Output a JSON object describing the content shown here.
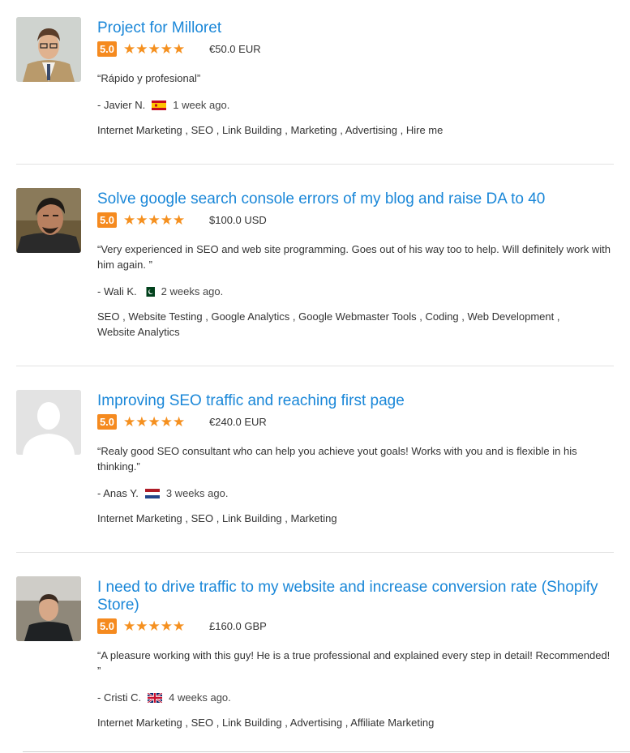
{
  "reviews": [
    {
      "title": "Project for Milloret",
      "score": "5.0",
      "stars": "★★★★★",
      "amount": "€50.0 EUR",
      "comment": "“Rápido y profesional”",
      "author": "- Javier N.",
      "flag": "spain-flag-icon",
      "ago": "1 week ago.",
      "skills": [
        "Internet Marketing",
        "SEO",
        "Link Building",
        "Marketing",
        "Advertising",
        "Hire me"
      ]
    },
    {
      "title": "Solve google search console errors of my blog and raise DA to 40",
      "score": "5.0",
      "stars": "★★★★★",
      "amount": "$100.0 USD",
      "comment": "“Very experienced in SEO and web site programming. Goes out of his way too to help. Will definitely work with him again. ”",
      "author": "- Wali K.",
      "flag": "pakistan-flag-icon",
      "ago": "2 weeks ago.",
      "skills": [
        "SEO",
        "Website Testing",
        "Google Analytics",
        "Google Webmaster Tools",
        "Coding",
        "Web Development",
        "Website Analytics"
      ]
    },
    {
      "title": "Improving SEO traffic and reaching first page",
      "score": "5.0",
      "stars": "★★★★★",
      "amount": "€240.0 EUR",
      "comment": "“Realy good SEO consultant who can help you achieve yout goals! Works with you and is flexible in his thinking.”",
      "author": "- Anas Y.",
      "flag": "netherlands-flag-icon",
      "ago": "3 weeks ago.",
      "skills": [
        "Internet Marketing",
        "SEO",
        "Link Building",
        "Marketing"
      ]
    },
    {
      "title": "I need to drive traffic to my website and increase conversion rate (Shopify Store)",
      "score": "5.0",
      "stars": "★★★★★",
      "amount": "£160.0 GBP",
      "comment": "“A pleasure working with this guy! He is a true professional and explained every step in detail! Recommended! ”",
      "author": "- Cristi C.",
      "flag": "uk-flag-icon",
      "ago": "4 weeks ago.",
      "skills": [
        "Internet Marketing",
        "SEO",
        "Link Building",
        "Advertising",
        "Affiliate Marketing"
      ]
    }
  ]
}
